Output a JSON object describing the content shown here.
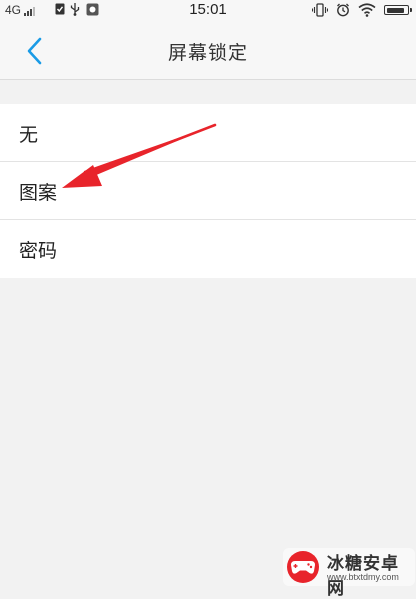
{
  "status_bar": {
    "network": "4G",
    "time": "15:01",
    "battery_level": 0.9,
    "icons": [
      "signal-icon",
      "sim-icon",
      "usb-icon",
      "app-notification-icon",
      "vibrate-icon",
      "alarm-icon",
      "wifi-icon",
      "battery-icon"
    ]
  },
  "header": {
    "title": "屏幕锁定",
    "back_icon": "chevron-left-icon"
  },
  "options": [
    {
      "label": "无"
    },
    {
      "label": "图案"
    },
    {
      "label": "密码"
    }
  ],
  "colors": {
    "accent": "#1a9be6",
    "annotation": "#e8242b",
    "background": "#f2f2f2"
  },
  "watermark": {
    "name": "冰糖安卓网",
    "url": "www.btxtdmy.com"
  }
}
